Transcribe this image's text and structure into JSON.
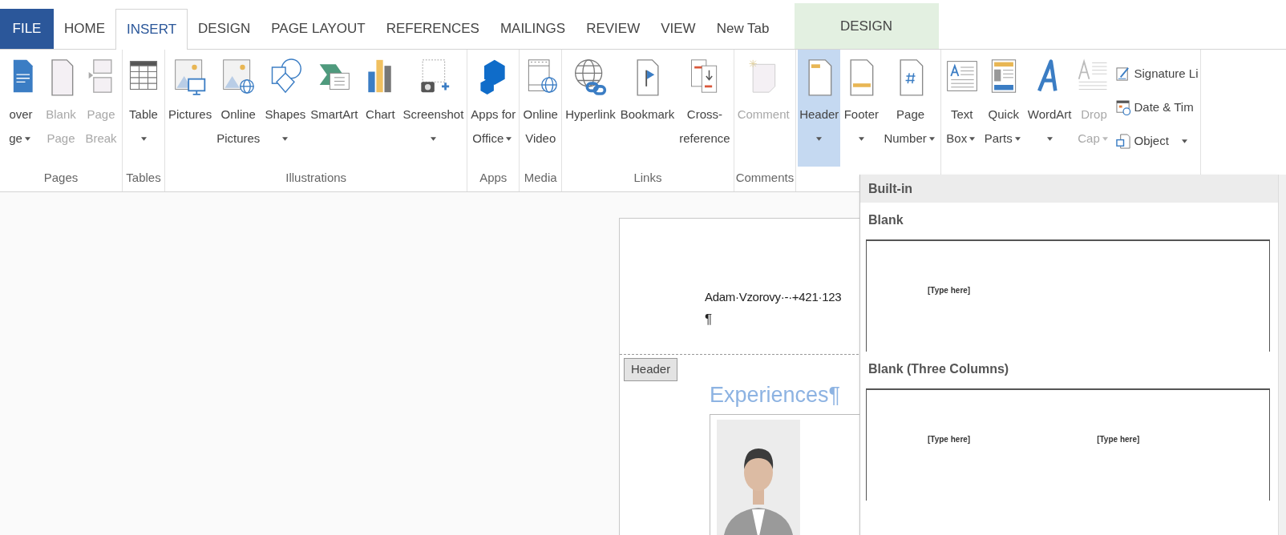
{
  "tabs": [
    {
      "label": "FILE",
      "kind": "file",
      "selected": false
    },
    {
      "label": "HOME",
      "kind": "normal",
      "selected": false
    },
    {
      "label": "INSERT",
      "kind": "normal",
      "selected": true
    },
    {
      "label": "DESIGN",
      "kind": "normal",
      "selected": false
    },
    {
      "label": "PAGE LAYOUT",
      "kind": "normal",
      "selected": false
    },
    {
      "label": "REFERENCES",
      "kind": "normal",
      "selected": false
    },
    {
      "label": "MAILINGS",
      "kind": "normal",
      "selected": false
    },
    {
      "label": "REVIEW",
      "kind": "normal",
      "selected": false
    },
    {
      "label": "VIEW",
      "kind": "normal",
      "selected": false
    },
    {
      "label": "New Tab",
      "kind": "normal",
      "selected": false
    },
    {
      "label": "DESIGN",
      "kind": "contextual",
      "selected": false
    }
  ],
  "ribbon": {
    "groups": [
      {
        "label": "Pages",
        "items": [
          {
            "lines": [
              "over",
              "ge"
            ],
            "dropdown": true,
            "disabled": false,
            "selected": false
          },
          {
            "lines": [
              "Blank",
              "Page"
            ],
            "dropdown": false,
            "disabled": true,
            "selected": false
          },
          {
            "lines": [
              "Page",
              "Break"
            ],
            "dropdown": false,
            "disabled": true,
            "selected": false
          }
        ]
      },
      {
        "label": "Tables",
        "items": [
          {
            "lines": [
              "Table"
            ],
            "dropdown": true,
            "disabled": false,
            "selected": false
          }
        ]
      },
      {
        "label": "Illustrations",
        "items": [
          {
            "lines": [
              "Pictures"
            ],
            "dropdown": false,
            "disabled": false,
            "selected": false
          },
          {
            "lines": [
              "Online",
              "Pictures"
            ],
            "dropdown": false,
            "disabled": false,
            "selected": false
          },
          {
            "lines": [
              "Shapes"
            ],
            "dropdown": true,
            "disabled": false,
            "selected": false
          },
          {
            "lines": [
              "SmartArt"
            ],
            "dropdown": false,
            "disabled": false,
            "selected": false
          },
          {
            "lines": [
              "Chart"
            ],
            "dropdown": false,
            "disabled": false,
            "selected": false
          },
          {
            "lines": [
              "Screenshot"
            ],
            "dropdown": true,
            "disabled": false,
            "selected": false
          }
        ]
      },
      {
        "label": "Apps",
        "items": [
          {
            "lines": [
              "Apps for",
              "Office"
            ],
            "dropdown": true,
            "disabled": false,
            "selected": false
          }
        ]
      },
      {
        "label": "Media",
        "items": [
          {
            "lines": [
              "Online",
              "Video"
            ],
            "dropdown": false,
            "disabled": false,
            "selected": false
          }
        ]
      },
      {
        "label": "Links",
        "items": [
          {
            "lines": [
              "Hyperlink"
            ],
            "dropdown": false,
            "disabled": false,
            "selected": false
          },
          {
            "lines": [
              "Bookmark"
            ],
            "dropdown": false,
            "disabled": false,
            "selected": false
          },
          {
            "lines": [
              "Cross-",
              "reference"
            ],
            "dropdown": false,
            "disabled": false,
            "selected": false
          }
        ]
      },
      {
        "label": "Comments",
        "items": [
          {
            "lines": [
              "Comment"
            ],
            "dropdown": false,
            "disabled": true,
            "selected": false
          }
        ]
      },
      {
        "items": [
          {
            "lines": [
              "Header"
            ],
            "dropdown": true,
            "disabled": false,
            "selected": true
          },
          {
            "lines": [
              "Footer"
            ],
            "dropdown": true,
            "disabled": false,
            "selected": false
          },
          {
            "lines": [
              "Page",
              "Number"
            ],
            "dropdown": true,
            "disabled": false,
            "selected": false
          }
        ]
      },
      {
        "items": [
          {
            "lines": [
              "Text",
              "Box"
            ],
            "dropdown": true,
            "disabled": false,
            "selected": false
          },
          {
            "lines": [
              "Quick",
              "Parts"
            ],
            "dropdown": true,
            "disabled": false,
            "selected": false
          },
          {
            "lines": [
              "WordArt"
            ],
            "dropdown": true,
            "disabled": false,
            "selected": false
          },
          {
            "lines": [
              "Drop",
              "Cap"
            ],
            "dropdown": true,
            "disabled": true,
            "selected": false
          }
        ],
        "side_items": [
          {
            "label": "Signature Li",
            "dropdown": false
          },
          {
            "label": "Date & Tim",
            "dropdown": false
          },
          {
            "label": "Object",
            "dropdown": true
          }
        ]
      }
    ]
  },
  "document": {
    "header_text": "Adam·Vzorovy·-·+421·123",
    "header_mark": "¶",
    "header_tag": "Header",
    "heading": "Experiences¶"
  },
  "header_gallery": {
    "category": "Built-in",
    "sections": [
      {
        "title": "Blank",
        "placeholders": [
          "[Type here]"
        ]
      },
      {
        "title": "Blank (Three Columns)",
        "placeholders": [
          "[Type here]",
          "[Type here]"
        ]
      }
    ]
  }
}
